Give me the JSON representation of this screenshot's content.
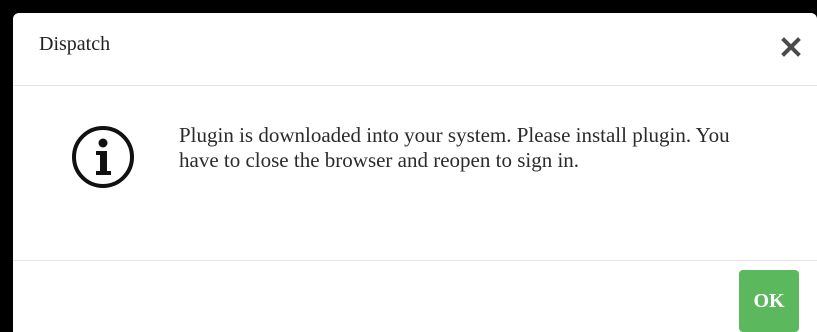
{
  "dialog": {
    "title": "Dispatch",
    "close_icon": "close-icon",
    "info_icon": "info-circle-icon",
    "message": "Plugin is downloaded into your system. Please install plugin. You have to close the browser and reopen to sign in.",
    "ok_label": "OK"
  },
  "colors": {
    "ok_button": "#5cb85c",
    "backdrop": "#000000",
    "dialog_background": "#ffffff",
    "divider": "#e5e5e5"
  }
}
